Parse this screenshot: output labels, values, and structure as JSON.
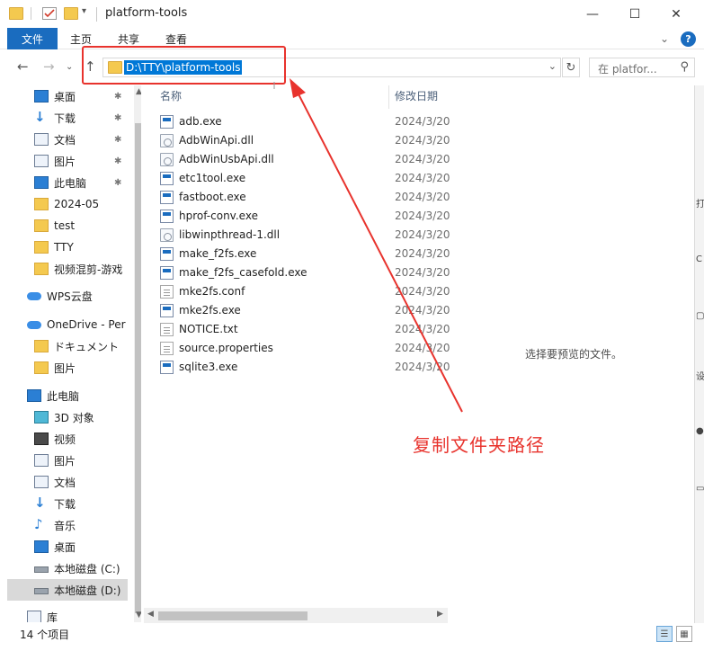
{
  "window": {
    "title": "platform-tools",
    "minimize_glyph": "—",
    "maximize_glyph": "☐",
    "close_glyph": "✕"
  },
  "ribbon": {
    "tabs": [
      "文件",
      "主页",
      "共享",
      "查看"
    ],
    "collapse_glyph": "⌄",
    "help_glyph": "?"
  },
  "nav": {
    "back_glyph": "←",
    "forward_glyph": "→",
    "history_glyph": "⌄",
    "up_glyph": "↑",
    "address_path": "D:\\TTY\\platform-tools",
    "address_dropdown_glyph": "⌄",
    "refresh_glyph": "↻",
    "search_placeholder": "在 platfor...",
    "search_glyph": "⚲"
  },
  "sidebar": {
    "items": [
      {
        "label": "桌面",
        "icon": "desktop-icon",
        "pinned": true
      },
      {
        "label": "下载",
        "icon": "download-icon",
        "pinned": true
      },
      {
        "label": "文档",
        "icon": "document-icon",
        "pinned": true
      },
      {
        "label": "图片",
        "icon": "picture-icon",
        "pinned": true
      },
      {
        "label": "此电脑",
        "icon": "pc-icon",
        "pinned": true
      },
      {
        "label": "2024-05",
        "icon": "folder-icon",
        "pinned": false
      },
      {
        "label": "test",
        "icon": "folder-icon",
        "pinned": false
      },
      {
        "label": "TTY",
        "icon": "folder-icon",
        "pinned": false
      },
      {
        "label": "视频混剪-游戏",
        "icon": "folder-icon",
        "pinned": false
      },
      {
        "label": "WPS云盘",
        "icon": "cloud-icon",
        "pinned": false
      },
      {
        "label": "OneDrive - Per",
        "icon": "onedrive-icon",
        "pinned": false
      },
      {
        "label": "ドキュメント",
        "icon": "folder-icon",
        "pinned": false
      },
      {
        "label": "图片",
        "icon": "folder-icon",
        "pinned": false
      },
      {
        "label": "此电脑",
        "icon": "pc-icon",
        "pinned": false
      },
      {
        "label": "3D 对象",
        "icon": "cube-3d-icon",
        "pinned": false
      },
      {
        "label": "视频",
        "icon": "video-icon",
        "pinned": false
      },
      {
        "label": "图片",
        "icon": "picture-icon",
        "pinned": false
      },
      {
        "label": "文档",
        "icon": "document-icon",
        "pinned": false
      },
      {
        "label": "下载",
        "icon": "download-icon",
        "pinned": false
      },
      {
        "label": "音乐",
        "icon": "music-icon",
        "pinned": false
      },
      {
        "label": "桌面",
        "icon": "desktop-icon",
        "pinned": false
      },
      {
        "label": "本地磁盘 (C:)",
        "icon": "drive-icon",
        "pinned": false
      },
      {
        "label": "本地磁盘 (D:)",
        "icon": "drive-icon",
        "pinned": false
      },
      {
        "label": "库",
        "icon": "library-icon",
        "pinned": false
      }
    ],
    "pin_glyph": "📌"
  },
  "files": {
    "columns": {
      "name": "名称",
      "modified": "修改日期"
    },
    "rows": [
      {
        "name": "adb.exe",
        "date": "2024/3/20",
        "type": "exe"
      },
      {
        "name": "AdbWinApi.dll",
        "date": "2024/3/20",
        "type": "dll"
      },
      {
        "name": "AdbWinUsbApi.dll",
        "date": "2024/3/20",
        "type": "dll"
      },
      {
        "name": "etc1tool.exe",
        "date": "2024/3/20",
        "type": "exe"
      },
      {
        "name": "fastboot.exe",
        "date": "2024/3/20",
        "type": "exe"
      },
      {
        "name": "hprof-conv.exe",
        "date": "2024/3/20",
        "type": "exe"
      },
      {
        "name": "libwinpthread-1.dll",
        "date": "2024/3/20",
        "type": "dll"
      },
      {
        "name": "make_f2fs.exe",
        "date": "2024/3/20",
        "type": "exe"
      },
      {
        "name": "make_f2fs_casefold.exe",
        "date": "2024/3/20",
        "type": "exe"
      },
      {
        "name": "mke2fs.conf",
        "date": "2024/3/20",
        "type": "txt"
      },
      {
        "name": "mke2fs.exe",
        "date": "2024/3/20",
        "type": "exe"
      },
      {
        "name": "NOTICE.txt",
        "date": "2024/3/20",
        "type": "txt"
      },
      {
        "name": "source.properties",
        "date": "2024/3/20",
        "type": "txt"
      },
      {
        "name": "sqlite3.exe",
        "date": "2024/3/20",
        "type": "exe"
      }
    ]
  },
  "preview": {
    "message": "选择要预览的文件。"
  },
  "annotation": {
    "text": "复制文件夹路径",
    "color": "#e8332d"
  },
  "status": {
    "item_count": "14 个项目"
  },
  "colors": {
    "accent": "#1a6cbf",
    "selection": "#0078d7",
    "folder": "#f4c94f"
  }
}
